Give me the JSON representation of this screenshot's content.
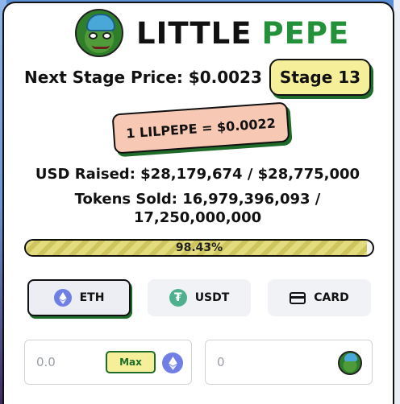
{
  "header": {
    "brand_word1": "LITTLE",
    "brand_word2": "PEPE"
  },
  "presale": {
    "next_stage_price": "Next Stage Price: $0.0023",
    "stage_label": "Stage 13",
    "rate": "1 LILPEPE = $0.0022",
    "usd_raised": "USD Raised: $28,179,674 / $28,775,000",
    "tokens_sold_line1": "Tokens Sold: 16,979,396,093 /",
    "tokens_sold_line2": "17,250,000,000",
    "progress_percent": 98.43,
    "progress_label": "98.43%"
  },
  "payment": {
    "options": [
      {
        "label": "ETH",
        "icon": "eth-icon",
        "active": true
      },
      {
        "label": "USDT",
        "icon": "usdt-icon",
        "active": false
      },
      {
        "label": "CARD",
        "icon": "card-icon",
        "active": false
      }
    ]
  },
  "inputs": {
    "pay_placeholder": "0.0",
    "max_label": "Max",
    "receive_placeholder": "0"
  },
  "colors": {
    "brand_green": "#22913a",
    "accent_yellow": "#f6ef99",
    "rate_peach": "#f7c8b4"
  }
}
